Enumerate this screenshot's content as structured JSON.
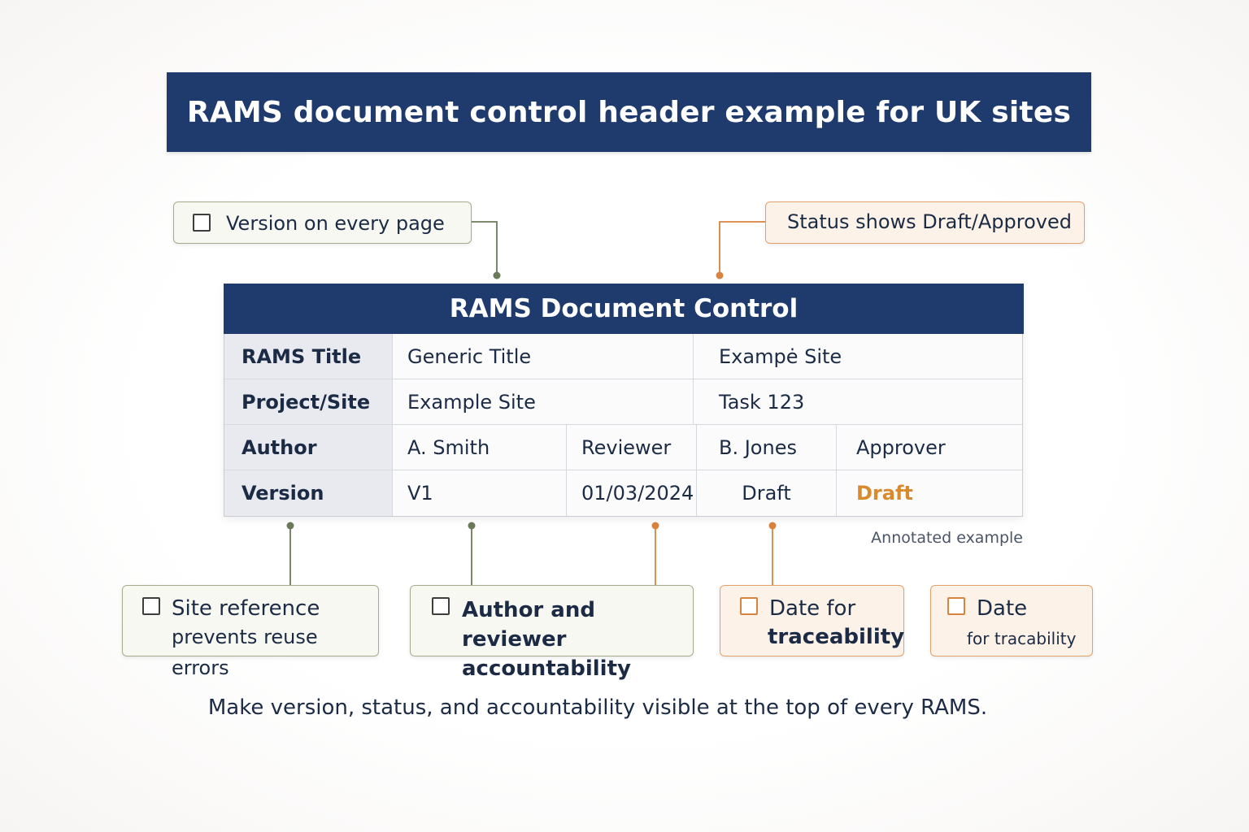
{
  "title": "RAMS document control header example for UK sites",
  "callouts": {
    "version_every_page": "Version on every page",
    "status": "Status shows Draft/Approved",
    "site_reference": {
      "line1": "Site reference",
      "line2": "prevents reuse errors"
    },
    "author_reviewer": {
      "line1": "Author and reviewer",
      "line2": "accountability"
    },
    "date_traceability": {
      "line1": "Date for",
      "line2": "traceability"
    },
    "date_tracability": {
      "line1": "Date",
      "line2": "for tracability"
    }
  },
  "table": {
    "header": "RAMS Document Control",
    "row1": {
      "label": "RAMS Title",
      "value": "Generic Title",
      "extra": "Exampė Site"
    },
    "row2": {
      "label": "Project/Site",
      "value": "Example Site",
      "extra": "Task 123"
    },
    "row3": {
      "label": "Author",
      "author": "A. Smith",
      "reviewer_label": "Reviewer",
      "reviewer": "B. Jones",
      "approver_label": "Approver"
    },
    "row4": {
      "label": "Version",
      "version": "V1",
      "date": "01/03/2024",
      "status_text": "Draft",
      "status_value": "Draft"
    }
  },
  "annotation_note": "Annotated example",
  "footer": "Make version, status, and accountability visible at the top of every RAMS.",
  "colors": {
    "navy": "#1f3a6d",
    "green_connector": "#6b7a58",
    "orange_connector": "#d9843e",
    "status_draft": "#d98a2c"
  }
}
